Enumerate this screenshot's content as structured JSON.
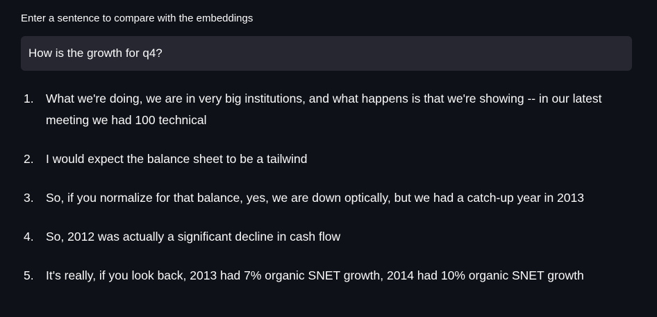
{
  "input": {
    "label": "Enter a sentence to compare with the embeddings",
    "value": "How is the growth for q4?"
  },
  "results": [
    {
      "number": "1.",
      "text": "What we're doing, we are in very big institutions, and what happens is that we're showing -- in our latest meeting we had 100 technical"
    },
    {
      "number": "2.",
      "text": "I would expect the balance sheet to be a tailwind"
    },
    {
      "number": "3.",
      "text": "So, if you normalize for that balance, yes, we are down optically, but we had a catch-up year in 2013"
    },
    {
      "number": "4.",
      "text": "So, 2012 was actually a significant decline in cash flow"
    },
    {
      "number": "5.",
      "text": "It's really, if you look back, 2013 had 7% organic SNET growth, 2014 had 10% organic SNET growth"
    }
  ],
  "colors": {
    "background": "#0e1117",
    "input_background": "#262730",
    "text": "#fafafa"
  }
}
